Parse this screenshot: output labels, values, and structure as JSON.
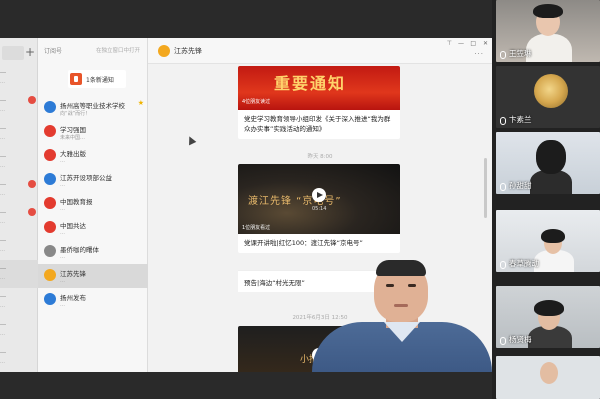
{
  "chat_list": {
    "rows": [
      {
        "title": "…",
        "snippet": "…"
      },
      {
        "title": "…",
        "snippet": "…"
      },
      {
        "title": "…",
        "snippet": "…"
      },
      {
        "title": "…",
        "snippet": "…"
      },
      {
        "title": "…",
        "snippet": "…"
      },
      {
        "title": "…",
        "snippet": "…"
      },
      {
        "title": "…",
        "snippet": "…"
      },
      {
        "title": "…",
        "snippet": "…"
      },
      {
        "title": "…",
        "snippet": "…"
      },
      {
        "title": "…",
        "snippet": "…"
      },
      {
        "title": "…",
        "snippet": "…"
      }
    ]
  },
  "subscriptions": {
    "header_title": "订阅号",
    "header_hint": "在独立窗口中打开",
    "notice": "1条新通知",
    "items": [
      {
        "name": "扬州高等职业技术学校",
        "snippet": "向“战”而行！",
        "color": "#2d7bd6",
        "starred": true
      },
      {
        "name": "学习强国",
        "snippet": "未来中国…",
        "color": "#e33b2f"
      },
      {
        "name": "大雅出版",
        "snippet": "…",
        "color": "#e33b2f"
      },
      {
        "name": "江苏开设项部公益",
        "snippet": "…",
        "color": "#2d7bd6"
      },
      {
        "name": "中国教育报",
        "snippet": "…",
        "color": "#e33b2f"
      },
      {
        "name": "中国共达",
        "snippet": "…",
        "color": "#e33b2f"
      },
      {
        "name": "墨侨咖的曙体",
        "snippet": "…",
        "color": "#888888"
      },
      {
        "name": "江苏先锋",
        "snippet": "…",
        "color": "#f3a81f",
        "selected": true
      },
      {
        "name": "扬州发布",
        "snippet": "…",
        "color": "#2d7bd6"
      }
    ]
  },
  "article": {
    "account_name": "江苏先锋",
    "card1": {
      "banner_text": "重要通知",
      "banner_caption": "4位朋友读过",
      "desc": "党史学习教育领导小组印发《关于深入推进“我为群众办实事”实践活动的通知》"
    },
    "stamp1": "昨天 8:00",
    "card2": {
      "banner_text": "渡江先锋 “京电号”",
      "duration": "05:14",
      "views": "1位朋友看过",
      "desc": "党课开讲啦|红忆100：渡江先锋“京电号”"
    },
    "sub_item": "预告|海边“村光无限”",
    "stamp2": "2021年6月3日 12:50",
    "card3": {
      "banner_text": "小推先锋"
    }
  },
  "participants": [
    {
      "name": "王笠琳"
    },
    {
      "name": "卞素兰"
    },
    {
      "name": "孙甜甜"
    },
    {
      "name": "春草腾动"
    },
    {
      "name": "杨贤梅"
    }
  ]
}
